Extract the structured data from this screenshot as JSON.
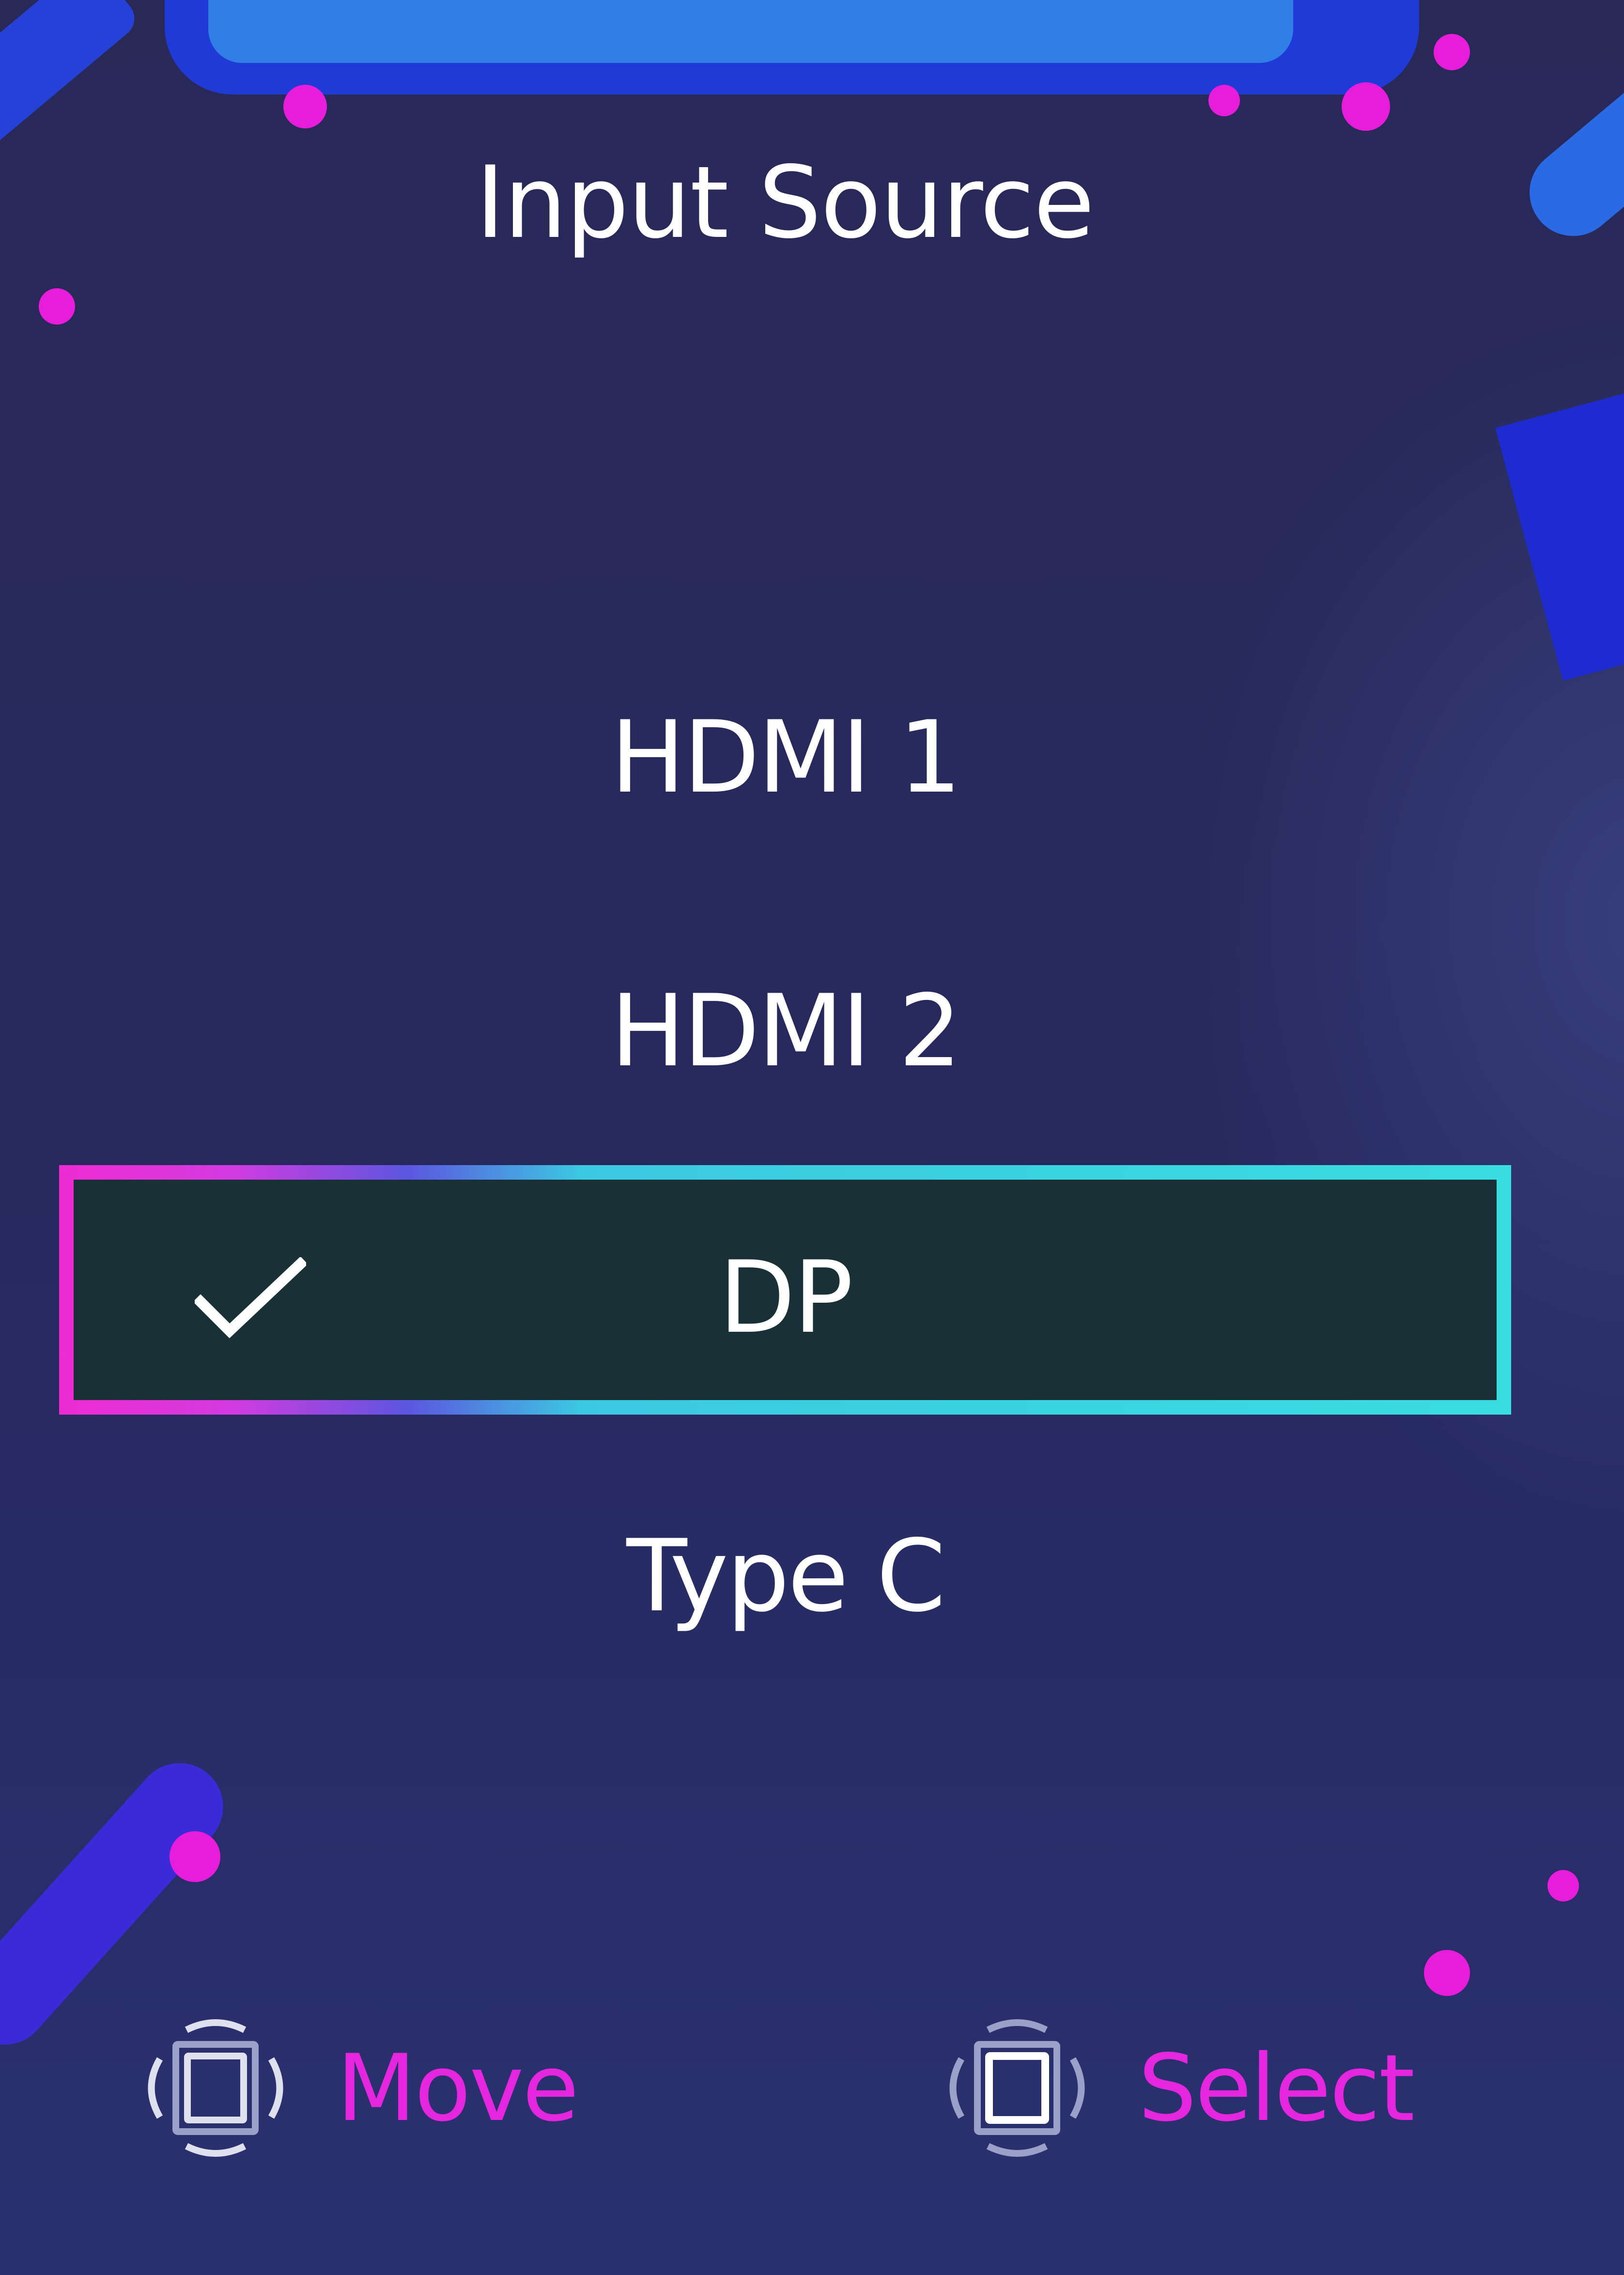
{
  "osd": {
    "title": "Input Source",
    "items": [
      {
        "label": "HDMI 1",
        "selected": false
      },
      {
        "label": "HDMI 2",
        "selected": false
      },
      {
        "label": "DP",
        "selected": true
      },
      {
        "label": "Type C",
        "selected": false
      }
    ],
    "selected_icon": "checkmark-icon"
  },
  "footer": {
    "move": {
      "icon": "joystick-move-icon",
      "label": "Move"
    },
    "select": {
      "icon": "joystick-press-icon",
      "label": "Select"
    }
  },
  "colors": {
    "background": "#27285f",
    "accent_magenta": "#e526df",
    "accent_cyan": "#39dde0",
    "selected_fill": "#183036",
    "text": "#ffffff"
  }
}
